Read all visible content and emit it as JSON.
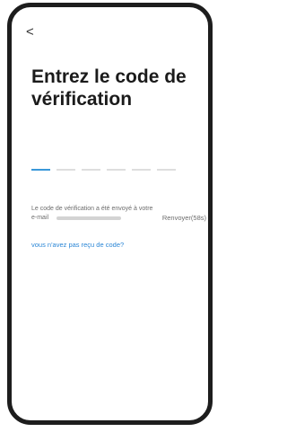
{
  "nav": {
    "back_glyph": "<"
  },
  "title": "Entrez le code de vérification",
  "code": {
    "slots": 6,
    "active_index": 0
  },
  "info": {
    "line1": "Le code de vérification a été envoyé à votre",
    "email_label": "e-mail",
    "resend_label": "Renvoyer(58s)"
  },
  "help_link": "vous n'avez pas reçu de code?",
  "colors": {
    "accent": "#3a98d9",
    "link": "#2a86d6",
    "title": "#1b1b1b"
  },
  "icons": {
    "back": "chevron-left-icon"
  }
}
